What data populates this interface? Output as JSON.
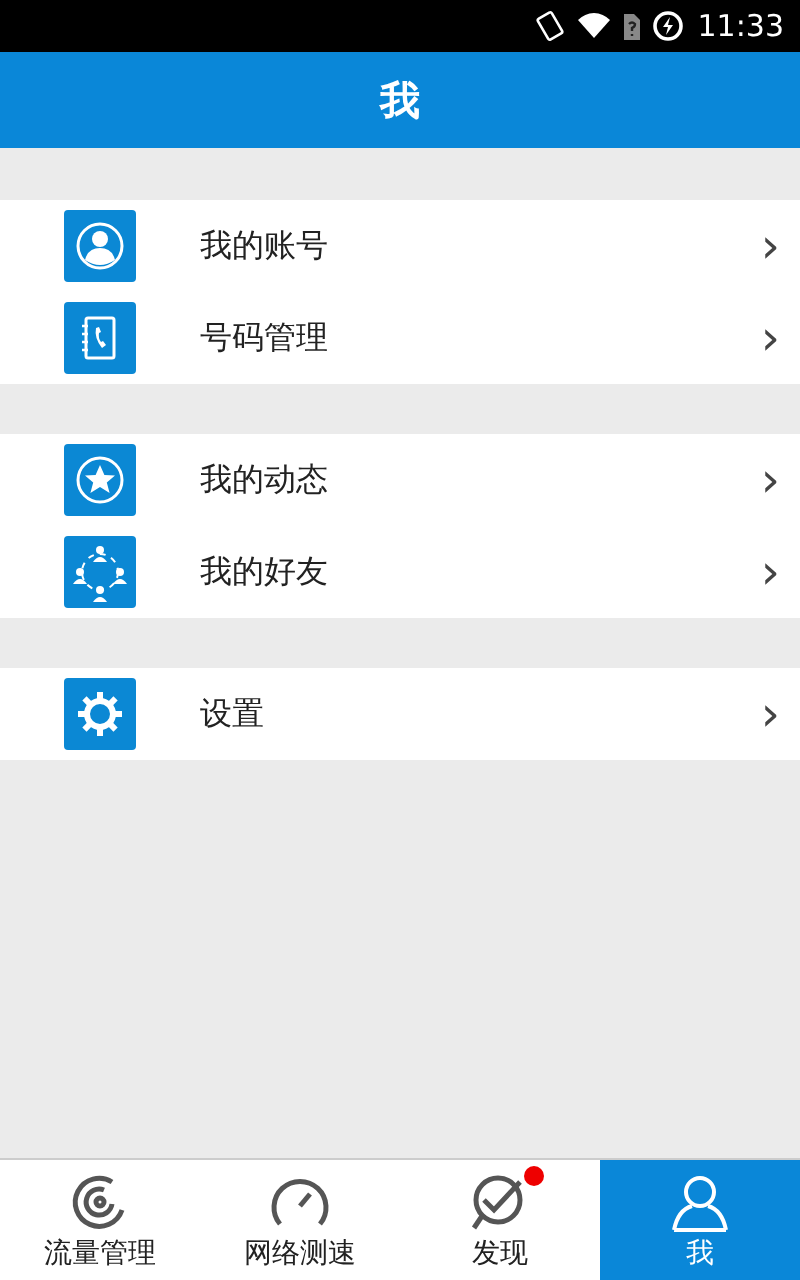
{
  "status_bar": {
    "time": "11:33"
  },
  "header": {
    "title": "我"
  },
  "groups": [
    {
      "items": [
        {
          "label": "我的账号",
          "chevron": "›"
        },
        {
          "label": "号码管理",
          "chevron": "›"
        }
      ]
    },
    {
      "items": [
        {
          "label": "我的动态",
          "chevron": "›"
        },
        {
          "label": "我的好友",
          "chevron": "›"
        }
      ]
    },
    {
      "items": [
        {
          "label": "设置",
          "chevron": "›"
        }
      ]
    }
  ],
  "tab_bar": [
    {
      "label": "流量管理",
      "selected": false,
      "badge": false
    },
    {
      "label": "网络测速",
      "selected": false,
      "badge": false
    },
    {
      "label": "发现",
      "selected": false,
      "badge": true
    },
    {
      "label": "我",
      "selected": true,
      "badge": false
    }
  ]
}
